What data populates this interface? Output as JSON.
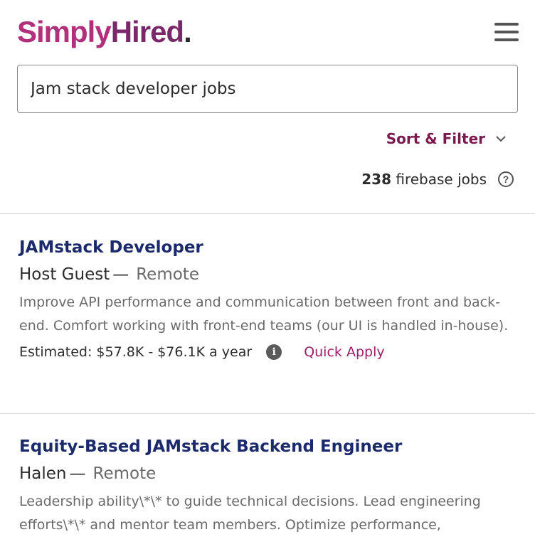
{
  "header": {
    "logo_simply": "Simply",
    "logo_hired": "Hired",
    "logo_dot": ".",
    "menu_icon": "hamburger-menu-icon"
  },
  "search": {
    "value": "Jam stack developer jobs"
  },
  "sort_filter": {
    "label": "Sort & Filter",
    "icon": "chevron-down-icon"
  },
  "results": {
    "count": "238",
    "label": "firebase jobs",
    "help_icon": "question-circle-icon"
  },
  "jobs": [
    {
      "title": "JAMstack Developer",
      "company": "Host Guest",
      "dash": "—",
      "location": "Remote",
      "snippet": "Improve API performance and communication between front and back-end. Comfort working with front-end teams (our UI is handled in-house).",
      "salary": "Estimated: $57.8K - $76.1K a year",
      "quick_apply": "Quick Apply"
    },
    {
      "title": "Equity-Based JAMstack Backend Engineer",
      "company": "Halen",
      "dash": "—",
      "location": "Remote",
      "snippet": "Leadership ability\\*\\* to guide technical decisions. Lead engineering efforts\\*\\* and mentor team members. Optimize performance,"
    }
  ],
  "colors": {
    "brand_pink": "#b0307c",
    "brand_purple": "#7a2a6a",
    "title_navy": "#1b2a6b",
    "accent": "#9a1f6a"
  }
}
